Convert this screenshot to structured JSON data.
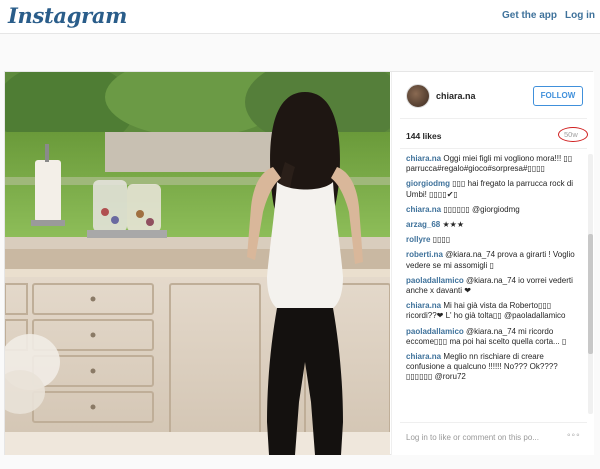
{
  "header": {
    "logo": "Instagram",
    "get_app": "Get the app",
    "login": "Log in"
  },
  "post": {
    "username": "chiara.na",
    "follow_label": "FOLLOW",
    "likes": "144 likes",
    "age": "50w",
    "footer_login": "Log in to like or comment on this po...",
    "more": "◦◦◦",
    "comments": [
      {
        "user": "chiara.na",
        "text": "Oggi miei figli mi vogliono mora!!! ▯▯ parrucca#regalo#gioco#sorpresa#▯▯▯▯"
      },
      {
        "user": "giorgiodmg",
        "text": "▯▯▯ hai fregato la parrucca rock di Umbi! ▯▯▯▯✔▯"
      },
      {
        "user": "chiara.na",
        "text": "▯▯▯▯▯▯ @giorgiodmg"
      },
      {
        "user": "arzag_68",
        "text": "★★★"
      },
      {
        "user": "rollyre",
        "text": "▯▯▯▯"
      },
      {
        "user": "roberti.na",
        "text": "@kiara.na_74 prova a girarti ! Voglio vedere se mi assomigli ▯"
      },
      {
        "user": "paoladallamico",
        "text": "@kiara.na_74 io vorrei vederti anche x davanti ❤"
      },
      {
        "user": "chiara.na",
        "text": "Mi hai già vista da Roberto▯▯▯ ricordi??❤ L' ho già tolta▯▯ @paoladallamico"
      },
      {
        "user": "paoladallamico",
        "text": "@kiara.na_74 mi ricordo eccome▯▯▯ ma poi hai scelto quella corta... ▯"
      },
      {
        "user": "chiara.na",
        "text": "Meglio nn rischiare di creare confusione a qualcuno !!!!!! No??? Ok???? ▯▯▯▯▯▯ @roru72"
      }
    ]
  }
}
